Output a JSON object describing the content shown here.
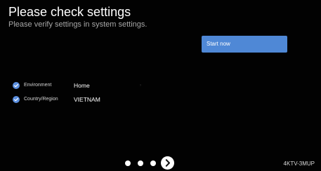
{
  "header": {
    "title": "Please check settings",
    "subtitle": "Please verify settings in system settings."
  },
  "actions": {
    "start_label": "Start now"
  },
  "settings": {
    "items": [
      {
        "label": "Environment",
        "value": "Home",
        "icon": "check-circle-icon",
        "arrow": "›"
      },
      {
        "label": "Country/Region",
        "value": "VIETNAM",
        "icon": "check-circle-icon"
      }
    ]
  },
  "pager": {
    "next_icon": "chevron-right-icon"
  },
  "footer": {
    "model": "4KTV-3MUP"
  },
  "colors": {
    "background": "#020202",
    "accent": "#4f88d6",
    "check": "#5b8fe0"
  }
}
